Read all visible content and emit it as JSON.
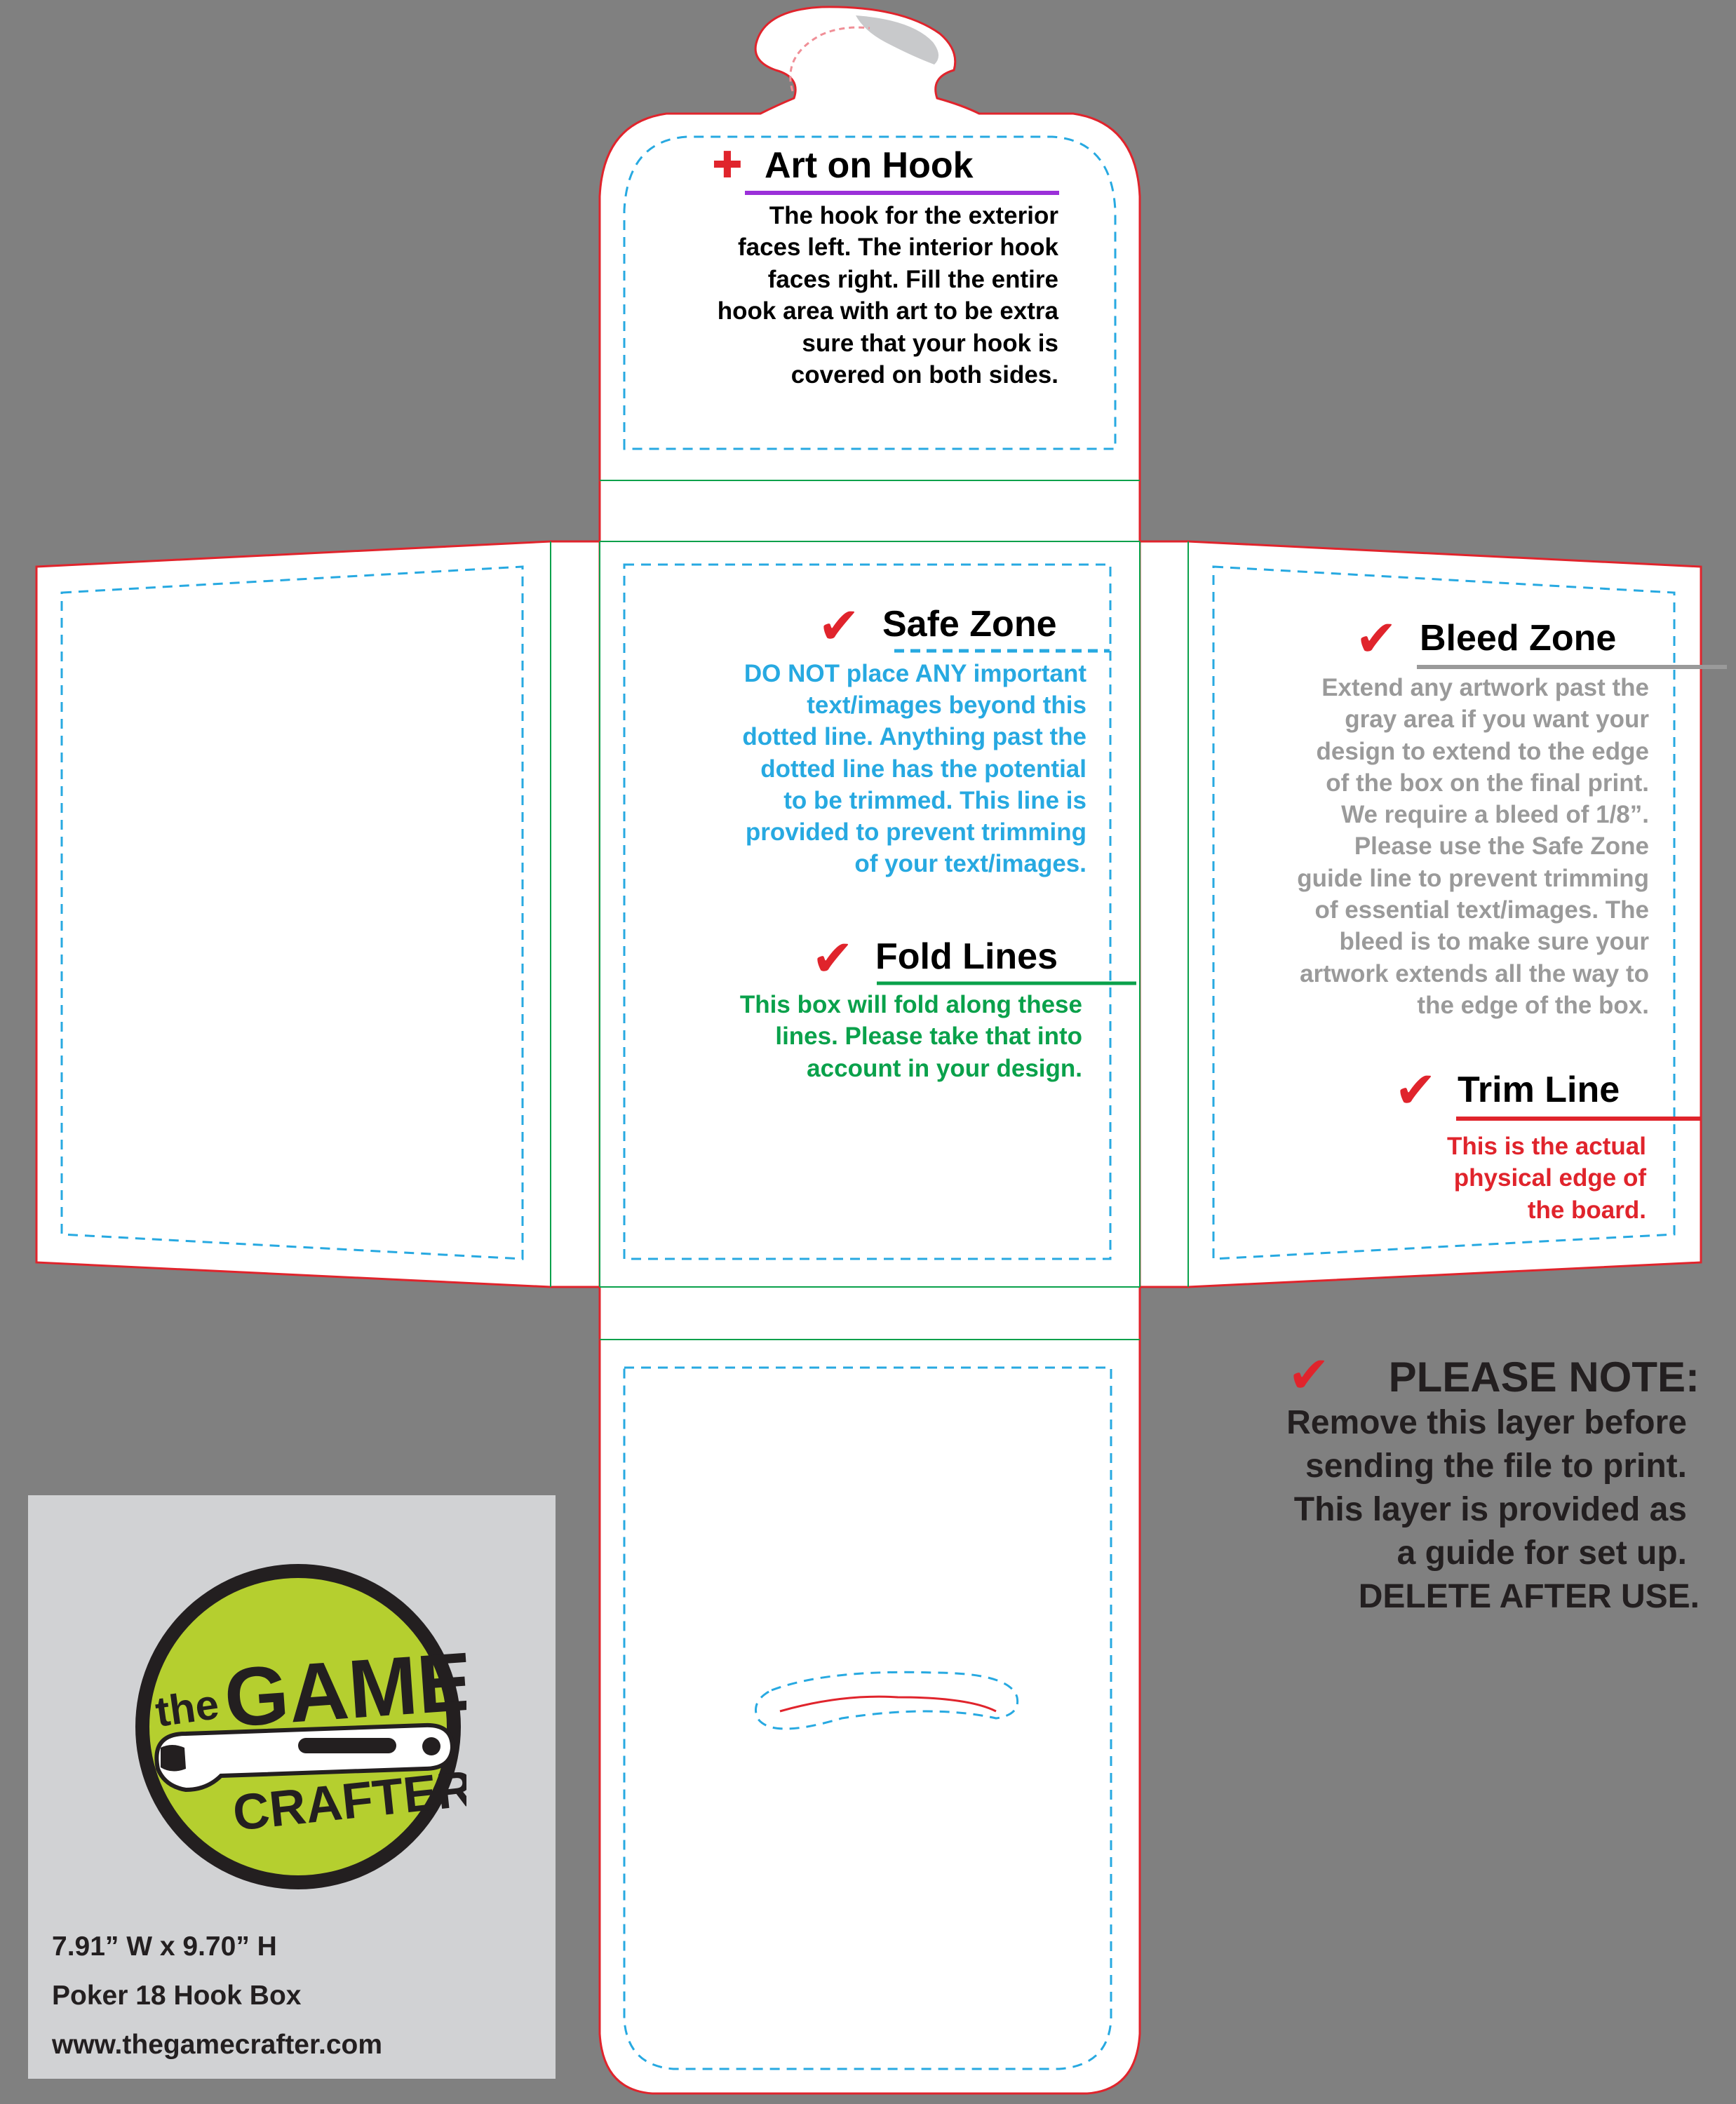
{
  "colors": {
    "background": "#808080",
    "trim_line": "#e0242c",
    "safe_zone": "#27a9e1",
    "fold_line": "#0aa14b",
    "bleed_zone": "#9a9a9a",
    "hook_underline": "#9b30d9",
    "logo_green": "#b5cf2f",
    "panel_gray": "#d1d2d4"
  },
  "icons": {
    "check": "check-mark-icon",
    "plus": "plus-icon"
  },
  "callouts": {
    "art_on_hook": {
      "symbol": "✚",
      "title": "Art on Hook",
      "lines": [
        "The hook for the exterior",
        "faces left. The interior hook",
        "faces right. Fill the entire",
        "hook area with art to be extra",
        "sure that your hook is",
        "covered on both sides."
      ]
    },
    "safe_zone": {
      "symbol": "✔",
      "title": "Safe Zone",
      "lines": [
        "DO NOT place ANY important",
        "text/images beyond this",
        "dotted line. Anything past the",
        "dotted line has the potential",
        "to be trimmed. This line is",
        "provided to prevent trimming",
        "of your text/images."
      ]
    },
    "fold_lines": {
      "symbol": "✔",
      "title": "Fold Lines",
      "lines": [
        "This box will fold along these",
        "lines. Please take that into",
        "account in your design."
      ]
    },
    "bleed_zone": {
      "symbol": "✔",
      "title": "Bleed Zone",
      "lines": [
        "Extend any artwork past the",
        "gray area if you want your",
        "design to extend to the edge",
        "of the box on the final print.",
        "We require a bleed of 1/8”.",
        "Please use the Safe Zone",
        "guide line to prevent trimming",
        "of essential text/images. The",
        "bleed is to make sure your",
        "artwork extends all the way to",
        "the edge of the box."
      ]
    },
    "trim_line": {
      "symbol": "✔",
      "title": "Trim Line",
      "lines": [
        "This is the actual",
        "physical edge of",
        "the board."
      ]
    }
  },
  "please_note": {
    "symbol": "✔",
    "title": "PLEASE NOTE:",
    "lines": [
      "Remove this layer before",
      "sending the file to print.",
      "This layer is provided as",
      "a guide for set up.",
      "DELETE AFTER USE."
    ]
  },
  "logo": {
    "word_the": "the",
    "word_game": "GAME",
    "word_crafter": "CRAFTER"
  },
  "product_info": {
    "dimensions": "7.91” W x 9.70” H",
    "product_name": "Poker 18 Hook Box",
    "website": "www.thegamecrafter.com"
  }
}
